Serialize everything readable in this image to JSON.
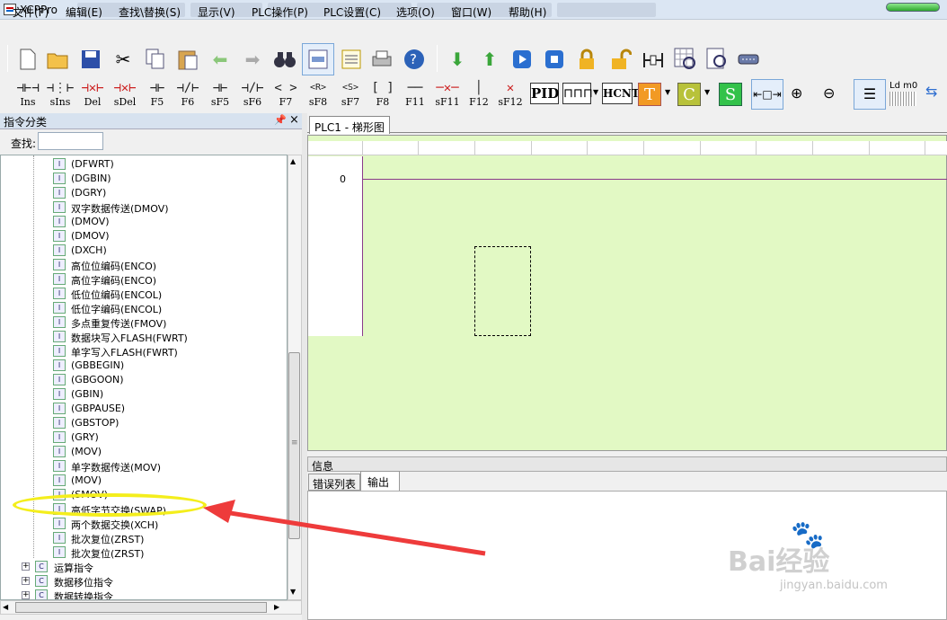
{
  "app": {
    "title": "XCPPro"
  },
  "menu": [
    "文件(F)",
    "编辑(E)",
    "查找\\替换(S)",
    "显示(V)",
    "PLC操作(P)",
    "PLC设置(C)",
    "选项(O)",
    "窗口(W)",
    "帮助(H)"
  ],
  "ladder_toolbar": [
    {
      "label": "Ins"
    },
    {
      "label": "sIns"
    },
    {
      "label": "Del"
    },
    {
      "label": "sDel"
    },
    {
      "label": "F5"
    },
    {
      "label": "F6"
    },
    {
      "label": "sF5"
    },
    {
      "label": "sF6"
    },
    {
      "label": "F7"
    },
    {
      "label": "sF8"
    },
    {
      "label": "sF7"
    },
    {
      "label": "F8"
    },
    {
      "label": "F11"
    },
    {
      "label": "sF11"
    },
    {
      "label": "F12"
    },
    {
      "label": "sF12"
    }
  ],
  "ladder_toolbar_extra": {
    "pid": "PID",
    "hcnt": "HCNT",
    "t": "T",
    "c": "C",
    "s": "S",
    "ldm0": "Ld m0"
  },
  "left_panel": {
    "title": "指令分类",
    "search_label": "查找:",
    "search_value": "",
    "items": [
      "(DFWRT)",
      "(DGBIN)",
      "(DGRY)",
      "双字数据传送(DMOV)",
      "(DMOV)",
      "(DMOV)",
      "(DXCH)",
      "高位位编码(ENCO)",
      "高位字编码(ENCO)",
      "低位位编码(ENCOL)",
      "低位字编码(ENCOL)",
      "多点重复传送(FMOV)",
      "数据块写入FLASH(FWRT)",
      "单字写入FLASH(FWRT)",
      "(GBBEGIN)",
      "(GBGOON)",
      "(GBIN)",
      "(GBPAUSE)",
      "(GBSTOP)",
      "(GRY)",
      "(MOV)",
      "单字数据传送(MOV)",
      "(MOV)",
      "(SMOV)",
      "高低字节交换(SWAP)",
      "两个数据交换(XCH)",
      "批次复位(ZRST)",
      "批次复位(ZRST)"
    ],
    "groups": [
      "运算指令",
      "数据移位指令",
      "数据转换指令"
    ]
  },
  "document": {
    "tab": "PLC1 - 梯形图",
    "row_number": "0"
  },
  "info_panel": {
    "title": "信息",
    "tabs": [
      "错误列表",
      "输出"
    ]
  },
  "watermark": {
    "text": "Bai经验",
    "url": "jingyan.baidu.com"
  },
  "colors": {
    "ladder_bg": "#e2f9c4",
    "rail": "#8a3b8a",
    "highlight": "#f4ee1c",
    "arrow": "#ee3b3b"
  }
}
